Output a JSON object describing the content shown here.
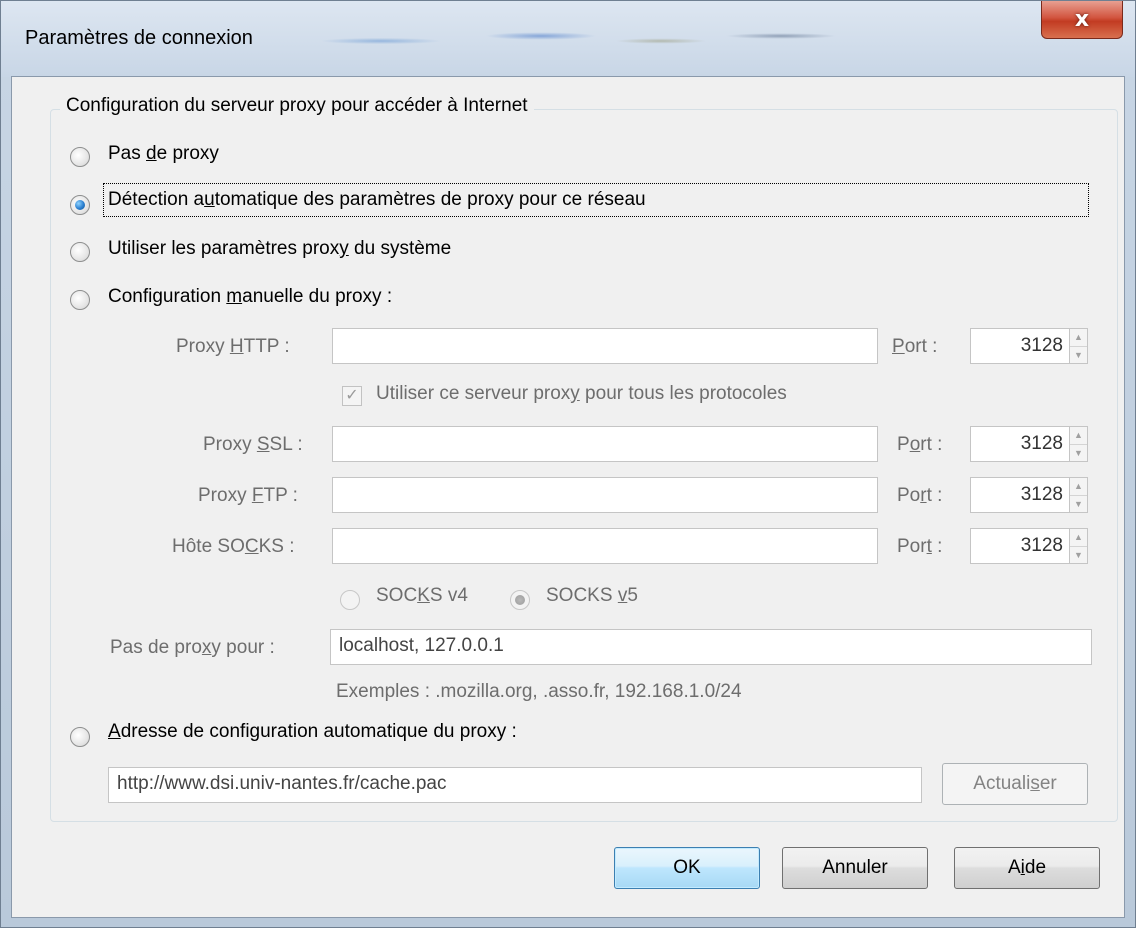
{
  "window": {
    "title": "Paramètres de connexion",
    "close_label": "x"
  },
  "group": {
    "legend": "Configuration du serveur proxy pour accéder à Internet"
  },
  "options": {
    "no_proxy": {
      "pre": "Pas ",
      "u": "d",
      "post": "e proxy",
      "selected": false
    },
    "auto_detect": {
      "pre": "Détection a",
      "u": "u",
      "post": "tomatique des paramètres de proxy pour ce réseau",
      "selected": true
    },
    "system": {
      "pre": "Utiliser les paramètres prox",
      "u": "y",
      "post": " du système",
      "selected": false
    },
    "manual": {
      "pre": "Configuration ",
      "u": "m",
      "post": "anuelle du proxy :",
      "selected": false
    },
    "pac": {
      "pre": "",
      "u": "A",
      "post": "dresse de configuration automatique du proxy :",
      "selected": false
    }
  },
  "manual": {
    "http": {
      "label_pre": "Proxy ",
      "label_u": "H",
      "label_post": "TTP :",
      "value": "",
      "port_pre": "",
      "port_u": "P",
      "port_post": "ort :",
      "port": "3128"
    },
    "share_all": {
      "pre": "Utiliser ce serveur prox",
      "u": "y",
      "post": " pour tous les protocoles",
      "checked": true
    },
    "ssl": {
      "label_pre": "Proxy ",
      "label_u": "S",
      "label_post": "SL :",
      "value": "",
      "port_pre": "P",
      "port_u": "o",
      "port_post": "rt :",
      "port": "3128"
    },
    "ftp": {
      "label_pre": "Proxy ",
      "label_u": "F",
      "label_post": "TP :",
      "value": "",
      "port_pre": "Po",
      "port_u": "r",
      "port_post": "t :",
      "port": "3128"
    },
    "socks": {
      "label_pre": "Hôte SO",
      "label_u": "C",
      "label_post": "KS :",
      "value": "",
      "port_pre": "Por",
      "port_u": "t",
      "port_post": " :",
      "port": "3128"
    },
    "socks_v4": {
      "pre": "SOC",
      "u": "K",
      "post": "S v4",
      "selected": false
    },
    "socks_v5": {
      "pre": "SOCKS ",
      "u": "v",
      "post": "5",
      "selected": true
    },
    "no_proxy_for": {
      "label_pre": "Pas de pro",
      "label_u": "x",
      "label_post": "y pour :",
      "value": "localhost, 127.0.0.1"
    },
    "examples": "Exemples : .mozilla.org, .asso.fr, 192.168.1.0/24"
  },
  "pac": {
    "url": "http://www.dsi.univ-nantes.fr/cache.pac",
    "reload_pre": "Actuali",
    "reload_u": "s",
    "reload_post": "er"
  },
  "buttons": {
    "ok": "OK",
    "cancel": "Annuler",
    "help_pre": "A",
    "help_u": "i",
    "help_post": "de"
  }
}
